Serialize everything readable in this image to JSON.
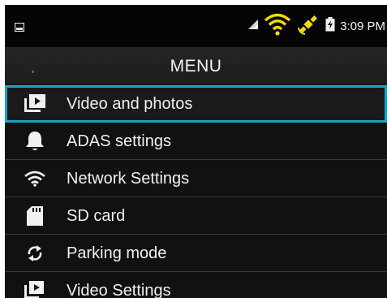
{
  "status_bar": {
    "time": "3:09 PM"
  },
  "menu": {
    "title": "MENU",
    "items": [
      {
        "label": "Video and photos",
        "icon": "video-library-icon",
        "selected": true
      },
      {
        "label": "ADAS settings",
        "icon": "bell-icon",
        "selected": false
      },
      {
        "label": "Network Settings",
        "icon": "wifi-icon",
        "selected": false
      },
      {
        "label": "SD card",
        "icon": "sd-card-icon",
        "selected": false
      },
      {
        "label": "Parking mode",
        "icon": "sync-icon",
        "selected": false
      },
      {
        "label": "Video Settings",
        "icon": "video-settings-icon",
        "selected": false
      }
    ]
  },
  "colors": {
    "accent": "#1aa3c4",
    "wifi": "#f5d90a",
    "gps": "#f5d90a"
  }
}
